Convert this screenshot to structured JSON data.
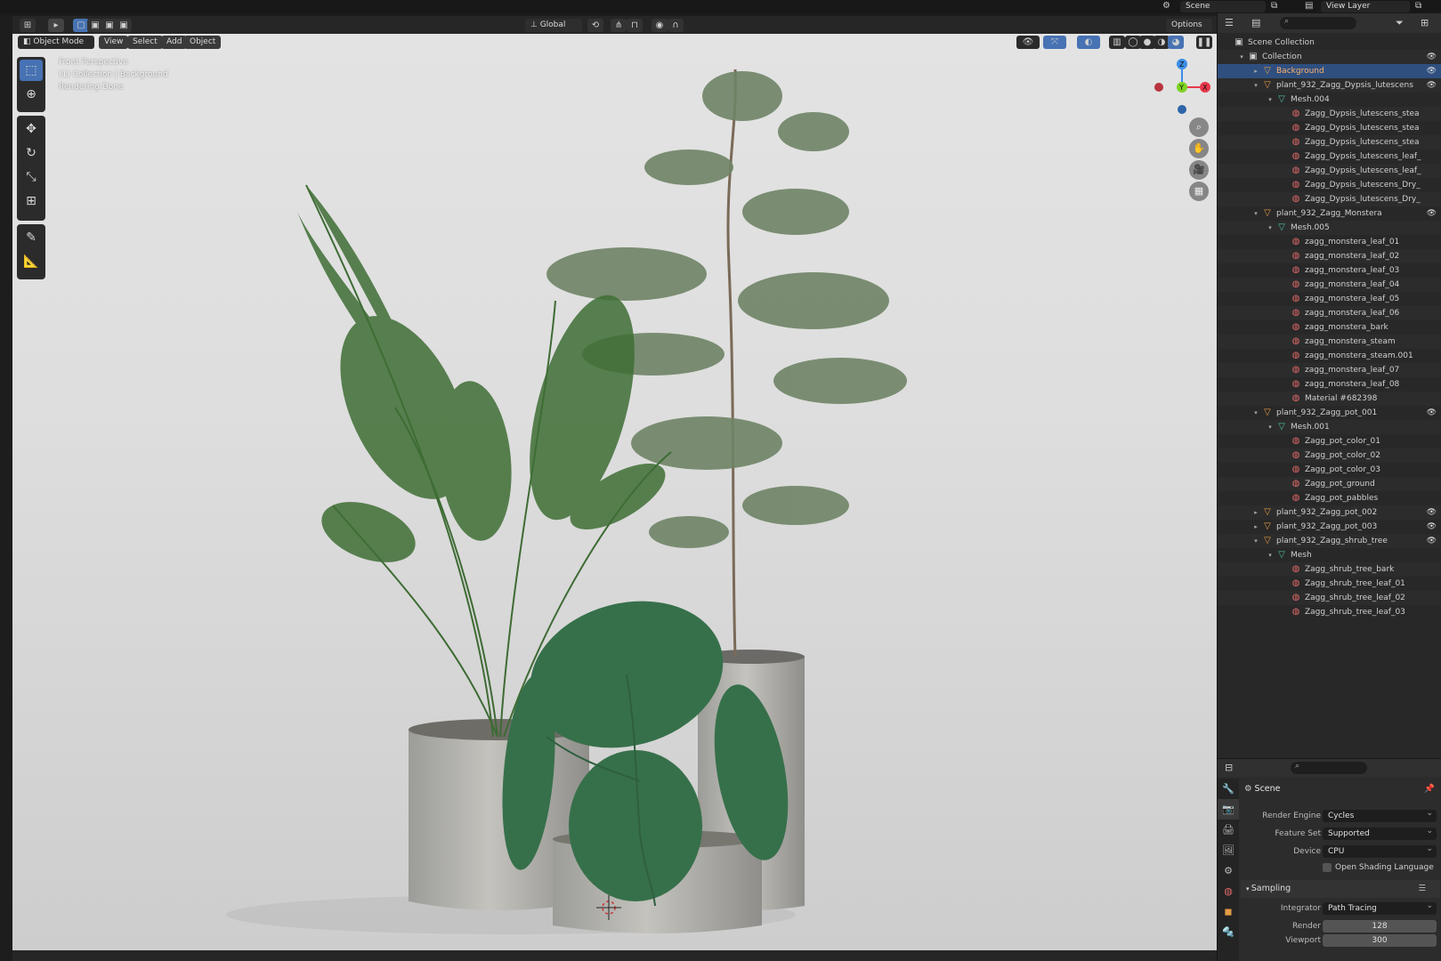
{
  "topbar": {
    "scene": "Scene",
    "view_layer": "View Layer"
  },
  "viewport_header": {
    "mode": "Object Mode",
    "menu": [
      "View",
      "Select",
      "Add",
      "Object"
    ],
    "transform_orientation": "Global",
    "options": "Options"
  },
  "viewport": {
    "overlay_line1": "Front Perspective",
    "overlay_line2": "(1) Collection | Background",
    "overlay_line3": "Rendering Done",
    "axis_z": "Z",
    "axis_y": "Y",
    "axis_x": "X"
  },
  "tools": [
    "select-box-icon",
    "cursor-icon",
    "move-icon",
    "rotate-icon",
    "scale-icon",
    "transform-icon",
    "annotate-icon",
    "measure-icon"
  ],
  "outliner": {
    "rows": [
      {
        "depth": 0,
        "type": "scene",
        "label": "Scene Collection",
        "arrow": "",
        "eye": false
      },
      {
        "depth": 1,
        "type": "col",
        "label": "Collection",
        "arrow": "▾",
        "eye": true
      },
      {
        "depth": 2,
        "type": "obj",
        "label": "Background",
        "arrow": "▸",
        "eye": true,
        "selected": true
      },
      {
        "depth": 2,
        "type": "obj",
        "label": "plant_932_Zagg_Dypsis_lutescens",
        "arrow": "▾",
        "eye": true
      },
      {
        "depth": 3,
        "type": "mesh",
        "label": "Mesh.004",
        "arrow": "▾"
      },
      {
        "depth": 4,
        "type": "mat",
        "label": "Zagg_Dypsis_lutescens_stea"
      },
      {
        "depth": 4,
        "type": "mat",
        "label": "Zagg_Dypsis_lutescens_stea"
      },
      {
        "depth": 4,
        "type": "mat",
        "label": "Zagg_Dypsis_lutescens_stea"
      },
      {
        "depth": 4,
        "type": "mat",
        "label": "Zagg_Dypsis_lutescens_leaf_"
      },
      {
        "depth": 4,
        "type": "mat",
        "label": "Zagg_Dypsis_lutescens_leaf_"
      },
      {
        "depth": 4,
        "type": "mat",
        "label": "Zagg_Dypsis_lutescens_Dry_"
      },
      {
        "depth": 4,
        "type": "mat",
        "label": "Zagg_Dypsis_lutescens_Dry_"
      },
      {
        "depth": 2,
        "type": "obj",
        "label": "plant_932_Zagg_Monstera",
        "arrow": "▾",
        "eye": true
      },
      {
        "depth": 3,
        "type": "mesh",
        "label": "Mesh.005",
        "arrow": "▾"
      },
      {
        "depth": 4,
        "type": "mat",
        "label": "zagg_monstera_leaf_01"
      },
      {
        "depth": 4,
        "type": "mat",
        "label": "zagg_monstera_leaf_02"
      },
      {
        "depth": 4,
        "type": "mat",
        "label": "zagg_monstera_leaf_03"
      },
      {
        "depth": 4,
        "type": "mat",
        "label": "zagg_monstera_leaf_04"
      },
      {
        "depth": 4,
        "type": "mat",
        "label": "zagg_monstera_leaf_05"
      },
      {
        "depth": 4,
        "type": "mat",
        "label": "zagg_monstera_leaf_06"
      },
      {
        "depth": 4,
        "type": "mat",
        "label": "zagg_monstera_bark"
      },
      {
        "depth": 4,
        "type": "mat",
        "label": "zagg_monstera_steam"
      },
      {
        "depth": 4,
        "type": "mat",
        "label": "zagg_monstera_steam.001"
      },
      {
        "depth": 4,
        "type": "mat",
        "label": "zagg_monstera_leaf_07"
      },
      {
        "depth": 4,
        "type": "mat",
        "label": "zagg_monstera_leaf_08"
      },
      {
        "depth": 4,
        "type": "mat",
        "label": "Material #682398"
      },
      {
        "depth": 2,
        "type": "obj",
        "label": "plant_932_Zagg_pot_001",
        "arrow": "▾",
        "eye": true
      },
      {
        "depth": 3,
        "type": "mesh",
        "label": "Mesh.001",
        "arrow": "▾"
      },
      {
        "depth": 4,
        "type": "mat",
        "label": "Zagg_pot_color_01"
      },
      {
        "depth": 4,
        "type": "mat",
        "label": "Zagg_pot_color_02"
      },
      {
        "depth": 4,
        "type": "mat",
        "label": "Zagg_pot_color_03"
      },
      {
        "depth": 4,
        "type": "mat",
        "label": "Zagg_pot_ground"
      },
      {
        "depth": 4,
        "type": "mat",
        "label": "Zagg_pot_pabbles"
      },
      {
        "depth": 2,
        "type": "obj",
        "label": "plant_932_Zagg_pot_002",
        "arrow": "▸",
        "eye": true
      },
      {
        "depth": 2,
        "type": "obj",
        "label": "plant_932_Zagg_pot_003",
        "arrow": "▸",
        "eye": true
      },
      {
        "depth": 2,
        "type": "obj",
        "label": "plant_932_Zagg_shrub_tree",
        "arrow": "▾",
        "eye": true
      },
      {
        "depth": 3,
        "type": "mesh",
        "label": "Mesh",
        "arrow": "▾"
      },
      {
        "depth": 4,
        "type": "mat",
        "label": "Zagg_shrub_tree_bark"
      },
      {
        "depth": 4,
        "type": "mat",
        "label": "Zagg_shrub_tree_leaf_01"
      },
      {
        "depth": 4,
        "type": "mat",
        "label": "Zagg_shrub_tree_leaf_02"
      },
      {
        "depth": 4,
        "type": "mat",
        "label": "Zagg_shrub_tree_leaf_03"
      }
    ]
  },
  "properties": {
    "context": "Scene",
    "render_engine_label": "Render Engine",
    "render_engine": "Cycles",
    "feature_set_label": "Feature Set",
    "feature_set": "Supported",
    "device_label": "Device",
    "device": "CPU",
    "osl_label": "Open Shading Language",
    "sampling_label": "Sampling",
    "integrator_label": "Integrator",
    "integrator": "Path Tracing",
    "render_label": "Render",
    "render_samples": "128",
    "viewport_label": "Viewport",
    "viewport_samples": "300"
  },
  "colors": {
    "accent": "#4772b3",
    "object_icon": "#e59b45",
    "mesh_icon": "#4fc1a9",
    "material_icon": "#e46a6a",
    "axis_x": "#e8394a",
    "axis_y": "#7ed321",
    "axis_z": "#3b8ee8"
  }
}
